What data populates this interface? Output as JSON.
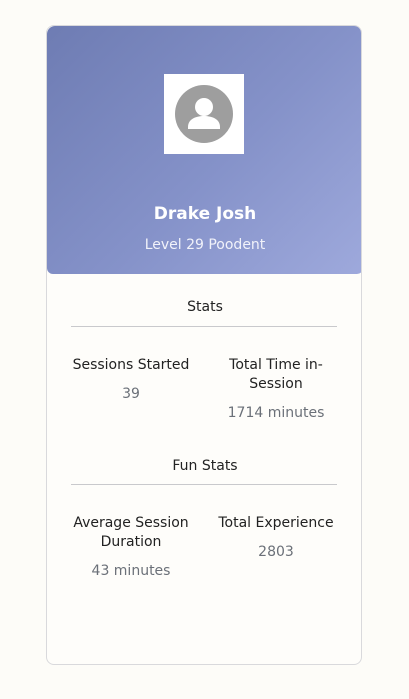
{
  "profile": {
    "name": "Drake Josh",
    "level_text": "Level 29 Poodent",
    "avatar_icon": "user-avatar-icon"
  },
  "stats": {
    "title": "Stats",
    "items": [
      {
        "label": "Sessions Started",
        "value": "39"
      },
      {
        "label": "Total Time in-Session",
        "value": "1714 minutes"
      }
    ]
  },
  "fun_stats": {
    "title": "Fun Stats",
    "items": [
      {
        "label": "Average Session Duration",
        "value": "43 minutes"
      },
      {
        "label": "Total Experience",
        "value": "2803"
      }
    ]
  },
  "colors": {
    "header_gradient_start": "#6e7cb3",
    "header_gradient_end": "#9ea9dc",
    "avatar_gray": "#9e9e9e"
  }
}
